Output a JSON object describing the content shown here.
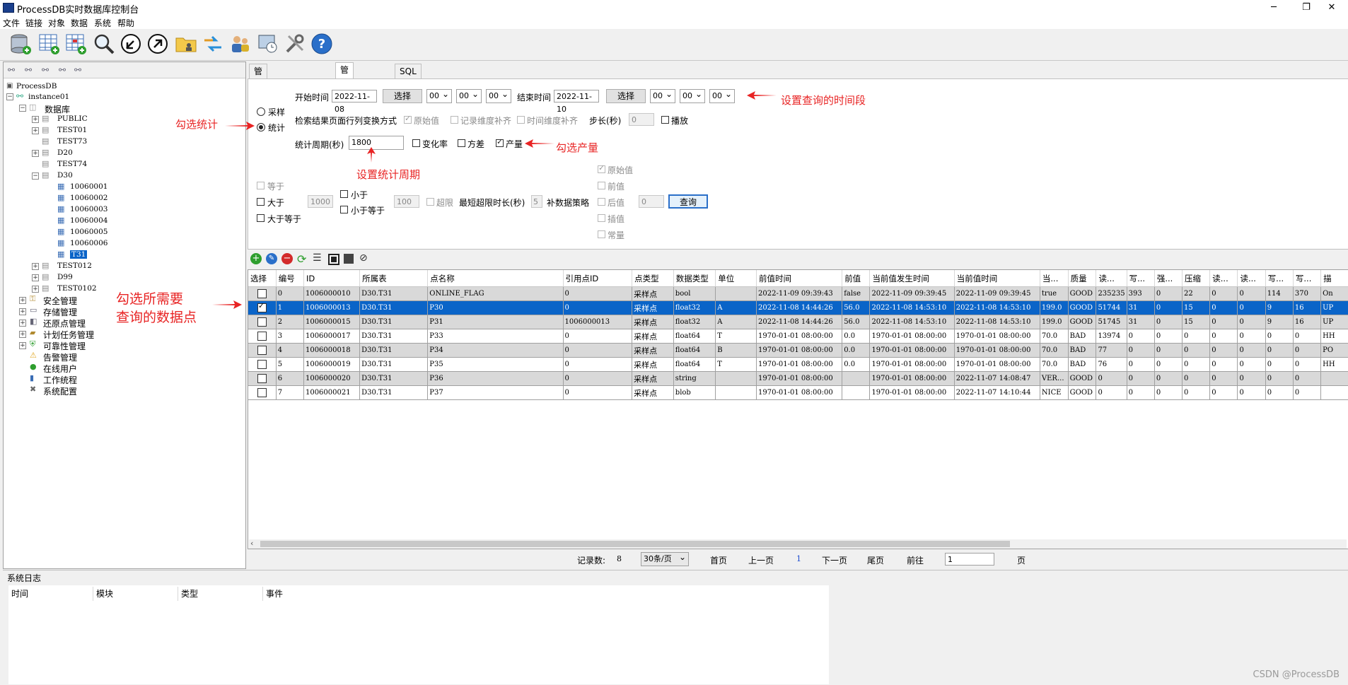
{
  "window": {
    "title": "ProcessDB实时数据库控制台",
    "minimize": "─",
    "restore": "❐",
    "close": "✕"
  },
  "menu": [
    "文件",
    "链接",
    "对象",
    "数据",
    "系统",
    "帮助"
  ],
  "tree": {
    "root": "ProcessDB",
    "instance": "instance01",
    "database": "数据库",
    "schemas": [
      "PUBLIC",
      "TEST01",
      "TEST73",
      "D20",
      "TEST74",
      "D30"
    ],
    "d30_children": [
      "10060001",
      "10060002",
      "10060003",
      "10060004",
      "10060005",
      "10060006",
      "T31"
    ],
    "after": [
      "TEST012",
      "D99",
      "TEST0102"
    ],
    "modules": [
      "安全管理",
      "存储管理",
      "还原点管理",
      "计划任务管理",
      "可靠性管理",
      "告警管理",
      "在线用户",
      "工作统程",
      "系统配置"
    ]
  },
  "tabs": [
    "管理测点及实时数据",
    "管理历史数据",
    "SQL"
  ],
  "query": {
    "start_label": "开始时间",
    "start_date": "2022-11-08",
    "select_btn": "选择",
    "hh": "00",
    "mm": "00",
    "ss": "00",
    "end_label": "结束时间",
    "end_date": "2022-11-10",
    "mode_sample": "采样",
    "mode_stat": "统计",
    "transform_label": "检索结果页面行列变换方式",
    "opt_raw": "原始值",
    "opt_record_fill": "记录维度补齐",
    "opt_time_fill": "时间维度补齐",
    "step_label": "步长(秒)",
    "step_value": "0",
    "play": "播放",
    "period_label": "统计周期(秒)",
    "period_value": "1800",
    "rate": "变化率",
    "variance": "方差",
    "output": "产量",
    "eq": "等于",
    "gt": "大于",
    "gt_value": "1000",
    "lt": "小于",
    "lt_value": "100",
    "ge": "大于等于",
    "le": "小于等于",
    "over": "超限",
    "min_over_label": "最短超限时长(秒)",
    "min_over_value": "5",
    "fill_strategy": "补数据策略",
    "fill_raw": "原始值",
    "fill_prev": "前值",
    "fill_next": "后值",
    "fill_next_value": "0",
    "fill_interp": "插值",
    "fill_const": "常量",
    "query_btn": "查询"
  },
  "annotations": {
    "time_range": "设置查询的时间段",
    "check_stat": "勾选统计",
    "check_output": "勾选产量",
    "period": "设置统计周期",
    "points_line1": "勾选所需要",
    "points_line2": "查询的数据点"
  },
  "grid": {
    "columns": [
      "选择",
      "编号",
      "ID",
      "所属表",
      "点名称",
      "引用点ID",
      "点类型",
      "数据类型",
      "单位",
      "前值时间",
      "前值",
      "当前值发生时间",
      "当前值时间",
      "当...",
      "质量",
      "读...",
      "写...",
      "强...",
      "压缩",
      "读...",
      "读...",
      "写...",
      "写...",
      "描"
    ],
    "rows": [
      {
        "checked": false,
        "cells": [
          "0",
          "1006000010",
          "D30.T31",
          "ONLINE_FLAG",
          "0",
          "采样点",
          "bool",
          "",
          "2022-11-09 09:39:43",
          "false",
          "2022-11-09 09:39:45",
          "2022-11-09 09:39:45",
          "true",
          "GOOD",
          "235235",
          "393",
          "0",
          "22",
          "0",
          "0",
          "114",
          "370",
          "On"
        ]
      },
      {
        "checked": true,
        "cells": [
          "1",
          "1006000013",
          "D30.T31",
          "P30",
          "0",
          "采样点",
          "float32",
          "A",
          "2022-11-08 14:44:26",
          "56.0",
          "2022-11-08 14:53:10",
          "2022-11-08 14:53:10",
          "199.0",
          "GOOD",
          "51744",
          "31",
          "0",
          "15",
          "0",
          "0",
          "9",
          "16",
          "UP"
        ]
      },
      {
        "checked": false,
        "cells": [
          "2",
          "1006000015",
          "D30.T31",
          "P31",
          "1006000013",
          "采样点",
          "float32",
          "A",
          "2022-11-08 14:44:26",
          "56.0",
          "2022-11-08 14:53:10",
          "2022-11-08 14:53:10",
          "199.0",
          "GOOD",
          "51745",
          "31",
          "0",
          "15",
          "0",
          "0",
          "9",
          "16",
          "UP"
        ]
      },
      {
        "checked": false,
        "cells": [
          "3",
          "1006000017",
          "D30.T31",
          "P33",
          "0",
          "采样点",
          "float64",
          "T",
          "1970-01-01 08:00:00",
          "0.0",
          "1970-01-01 08:00:00",
          "1970-01-01 08:00:00",
          "70.0",
          "BAD",
          "13974",
          "0",
          "0",
          "0",
          "0",
          "0",
          "0",
          "0",
          "HH"
        ]
      },
      {
        "checked": false,
        "cells": [
          "4",
          "1006000018",
          "D30.T31",
          "P34",
          "0",
          "采样点",
          "float64",
          "B",
          "1970-01-01 08:00:00",
          "0.0",
          "1970-01-01 08:00:00",
          "1970-01-01 08:00:00",
          "70.0",
          "BAD",
          "77",
          "0",
          "0",
          "0",
          "0",
          "0",
          "0",
          "0",
          "PO"
        ]
      },
      {
        "checked": false,
        "cells": [
          "5",
          "1006000019",
          "D30.T31",
          "P35",
          "0",
          "采样点",
          "float64",
          "T",
          "1970-01-01 08:00:00",
          "0.0",
          "1970-01-01 08:00:00",
          "1970-01-01 08:00:00",
          "70.0",
          "BAD",
          "76",
          "0",
          "0",
          "0",
          "0",
          "0",
          "0",
          "0",
          "HH"
        ]
      },
      {
        "checked": false,
        "cells": [
          "6",
          "1006000020",
          "D30.T31",
          "P36",
          "0",
          "采样点",
          "string",
          "",
          "1970-01-01 08:00:00",
          "",
          "1970-01-01 08:00:00",
          "2022-11-07 14:08:47",
          "VER...",
          "GOOD",
          "0",
          "0",
          "0",
          "0",
          "0",
          "0",
          "0",
          "0",
          ""
        ]
      },
      {
        "checked": false,
        "cells": [
          "7",
          "1006000021",
          "D30.T31",
          "P37",
          "0",
          "采样点",
          "blob",
          "",
          "1970-01-01 08:00:00",
          "",
          "1970-01-01 08:00:00",
          "2022-11-07 14:10:44",
          "NICE",
          "GOOD",
          "0",
          "0",
          "0",
          "0",
          "0",
          "0",
          "0",
          "0",
          ""
        ]
      }
    ]
  },
  "pager": {
    "count_label": "记录数:",
    "count": "8",
    "page_size": "30条/页",
    "first": "首页",
    "prev": "上一页",
    "current": "1",
    "next": "下一页",
    "last": "尾页",
    "goto": "前往",
    "goto_value": "1",
    "page_unit": "页"
  },
  "log": {
    "title": "系统日志",
    "columns": [
      "时间",
      "模块",
      "类型",
      "事件"
    ]
  },
  "watermark": "CSDN @ProcessDB"
}
